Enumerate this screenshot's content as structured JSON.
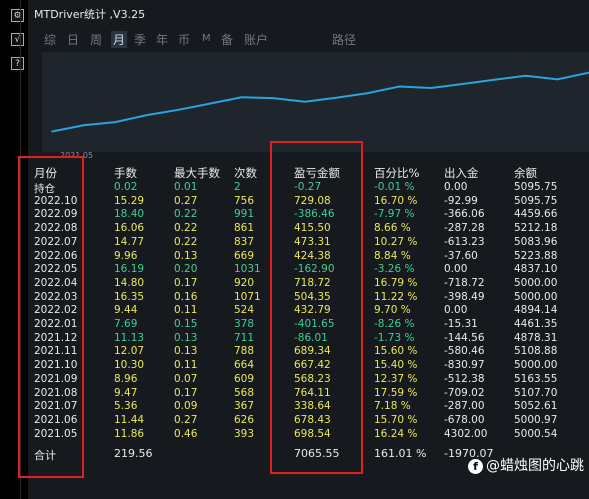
{
  "window": {
    "title": "MTDriver统计 ,V3.25"
  },
  "left_toolbar": {
    "buttons": [
      {
        "name": "gear-icon",
        "glyph": "⚙"
      },
      {
        "name": "checkmark-icon",
        "glyph": "√"
      },
      {
        "name": "help-icon",
        "glyph": "?"
      }
    ]
  },
  "tabs": [
    "综",
    "日",
    "周",
    "月",
    "季",
    "年",
    "币",
    "M",
    "备",
    "账户",
    "路径"
  ],
  "active_tab": "月",
  "chart_data": {
    "type": "line",
    "x": [
      "2021.05",
      "2021.06",
      "2021.07",
      "2021.08",
      "2021.09",
      "2021.10",
      "2021.11",
      "2021.12",
      "2022.01",
      "2022.02",
      "2022.03",
      "2022.04",
      "2022.05",
      "2022.06",
      "2022.07",
      "2022.08",
      "2022.09",
      "2022.10"
    ],
    "series": [
      {
        "values": [
          698.54,
          1376.97,
          1715.61,
          2479.72,
          3047.95,
          3715.37,
          4404.71,
          4318.7,
          3917.05,
          4349.84,
          4854.19,
          5572.91,
          5410.01,
          5834.39,
          6307.7,
          6723.2,
          6336.74,
          7065.82
        ]
      }
    ],
    "color": "#2aa3e0",
    "x_tick_labels": [
      "2021.05"
    ],
    "ylim": [
      0,
      8000
    ]
  },
  "table": {
    "headers": [
      "月份",
      "手数",
      "最大手数",
      "次数",
      "盈亏金额",
      "百分比%",
      "出入金",
      "余额"
    ],
    "rows": [
      [
        "持仓",
        "0.02",
        "0.01",
        "2",
        "-0.27",
        "-0.01 %",
        "0.00",
        "5095.75"
      ],
      [
        "2022.10",
        "15.29",
        "0.27",
        "756",
        "729.08",
        "16.70 %",
        "-92.99",
        "5095.75"
      ],
      [
        "2022.09",
        "18.40",
        "0.22",
        "991",
        "-386.46",
        "-7.97 %",
        "-366.06",
        "4459.66"
      ],
      [
        "2022.08",
        "16.06",
        "0.22",
        "861",
        "415.50",
        "8.66 %",
        "-287.28",
        "5212.18"
      ],
      [
        "2022.07",
        "14.77",
        "0.22",
        "837",
        "473.31",
        "10.27 %",
        "-613.23",
        "5083.96"
      ],
      [
        "2022.06",
        "9.96",
        "0.13",
        "669",
        "424.38",
        "8.84 %",
        "-37.60",
        "5223.88"
      ],
      [
        "2022.05",
        "16.19",
        "0.20",
        "1031",
        "-162.90",
        "-3.26 %",
        "0.00",
        "4837.10"
      ],
      [
        "2022.04",
        "14.80",
        "0.17",
        "920",
        "718.72",
        "16.79 %",
        "-718.72",
        "5000.00"
      ],
      [
        "2022.03",
        "16.35",
        "0.16",
        "1071",
        "504.35",
        "11.22 %",
        "-398.49",
        "5000.00"
      ],
      [
        "2022.02",
        "9.44",
        "0.11",
        "524",
        "432.79",
        "9.70 %",
        "0.00",
        "4894.14"
      ],
      [
        "2022.01",
        "7.69",
        "0.15",
        "378",
        "-401.65",
        "-8.26 %",
        "-15.31",
        "4461.35"
      ],
      [
        "2021.12",
        "11.13",
        "0.13",
        "711",
        "-86.01",
        "-1.73 %",
        "-144.56",
        "4878.31"
      ],
      [
        "2021.11",
        "12.07",
        "0.13",
        "788",
        "689.34",
        "15.60 %",
        "-580.46",
        "5108.88"
      ],
      [
        "2021.10",
        "10.30",
        "0.11",
        "664",
        "667.42",
        "15.40 %",
        "-830.97",
        "5000.00"
      ],
      [
        "2021.09",
        "8.96",
        "0.07",
        "609",
        "568.23",
        "12.37 %",
        "-512.38",
        "5163.55"
      ],
      [
        "2021.08",
        "9.47",
        "0.17",
        "568",
        "764.11",
        "17.59 %",
        "-709.02",
        "5107.70"
      ],
      [
        "2021.07",
        "5.36",
        "0.09",
        "367",
        "338.64",
        "7.18 %",
        "-287.00",
        "5052.61"
      ],
      [
        "2021.06",
        "11.44",
        "0.27",
        "626",
        "678.43",
        "15.70 %",
        "-678.00",
        "5000.97"
      ],
      [
        "2021.05",
        "11.86",
        "0.46",
        "393",
        "698.54",
        "16.24 %",
        "4302.00",
        "5000.54"
      ]
    ],
    "row_colors": {
      "positive": "#e8e85a",
      "negative": "#3ecf8e"
    },
    "footer": {
      "label": "合计",
      "lots": "219.56",
      "profit": "7065.55",
      "percent": "161.01 %",
      "flow": "-1970.07"
    }
  },
  "watermark": {
    "icon": "facebook-icon",
    "text": "@蜡烛图的心跳"
  },
  "colors": {
    "highlight_box": "#e02020",
    "background": "#161a1f",
    "chart_bg": "#1e252d"
  }
}
